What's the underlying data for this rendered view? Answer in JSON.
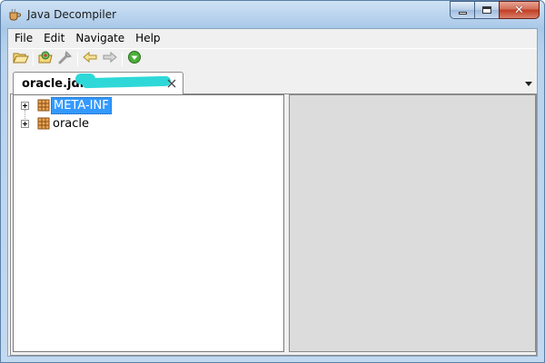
{
  "window": {
    "title": "Java Decompiler",
    "minimize_glyph": "—",
    "maximize_glyph": "☐",
    "close_glyph": "✕"
  },
  "menu": [
    "File",
    "Edit",
    "Navigate",
    "Help"
  ],
  "toolbar": {
    "buttons": [
      "open-icon",
      "open-type-icon",
      "search-icon",
      "back-icon",
      "forward-icon",
      "about-icon"
    ]
  },
  "tab": {
    "label": "oracle.jdbc.10",
    "close_glyph": "✕",
    "menu_glyph": "▼"
  },
  "tree": {
    "items": [
      {
        "label": "META-INF",
        "selected": true
      },
      {
        "label": "oracle",
        "selected": false
      }
    ]
  },
  "colors": {
    "selection": "#3399ff",
    "redaction": "#2fd8d8",
    "right_pane": "#dcdcdc"
  }
}
